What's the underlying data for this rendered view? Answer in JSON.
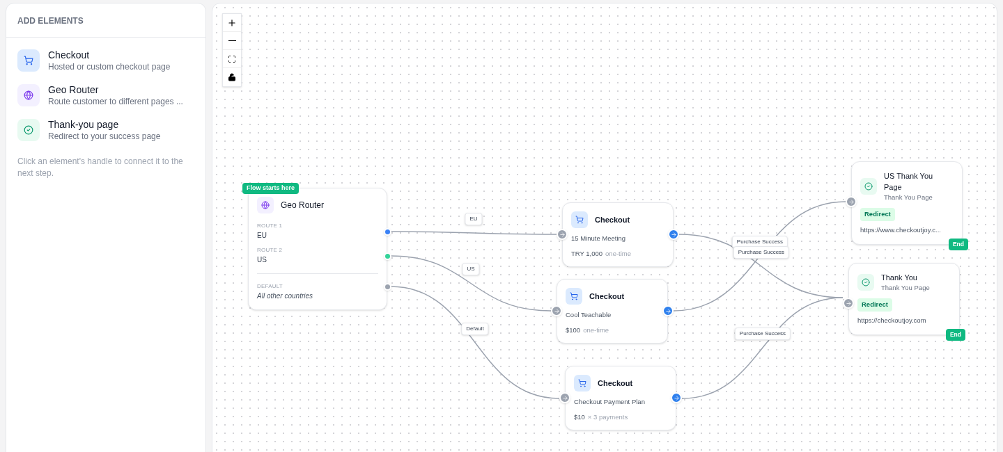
{
  "sidebar": {
    "title": "ADD ELEMENTS",
    "items": [
      {
        "kind": "checkout",
        "title": "Checkout",
        "description": "Hosted or custom checkout page"
      },
      {
        "kind": "router",
        "title": "Geo Router",
        "description": "Route customer to different pages ..."
      },
      {
        "kind": "thankyou",
        "title": "Thank-you page",
        "description": "Redirect to your success page"
      }
    ],
    "hint": "Click an element's handle to connect it to the next step."
  },
  "canvas": {
    "nodes": [
      {
        "kind": "router",
        "badge": "Flow starts here",
        "title": "Geo Router",
        "routes": [
          {
            "label": "ROUTE 1",
            "value": "EU",
            "color": "#3b82f6"
          },
          {
            "label": "ROUTE 2",
            "value": "US",
            "color": "#34d399"
          }
        ],
        "default": {
          "label": "DEFAULT",
          "value": "All other countries"
        }
      },
      {
        "kind": "checkout",
        "title": "Checkout",
        "name": "15 Minute Meeting",
        "price": "TRY 1,000",
        "price_note": "one-time"
      },
      {
        "kind": "checkout",
        "title": "Checkout",
        "name": "Cool Teachable",
        "price": "$100",
        "price_note": "one-time"
      },
      {
        "kind": "checkout",
        "title": "Checkout",
        "name": "Checkout Payment Plan",
        "price": "$10",
        "price_note": "× 3 payments"
      },
      {
        "kind": "thankyou",
        "title": "US Thank You Page",
        "subtitle": "Thank You Page",
        "tag": "Redirect",
        "url": "https://www.checkoutjoy.c...",
        "end": "End"
      },
      {
        "kind": "thankyou",
        "title": "Thank You",
        "subtitle": "Thank You Page",
        "tag": "Redirect",
        "url": "https://checkoutjoy.com",
        "end": "End"
      }
    ],
    "edges": [
      {
        "label": "EU"
      },
      {
        "label": "US"
      },
      {
        "label": "Default"
      },
      {
        "label": "Purchase Success"
      },
      {
        "label": "Purchase Success"
      },
      {
        "label": "Purchase Success"
      }
    ]
  }
}
